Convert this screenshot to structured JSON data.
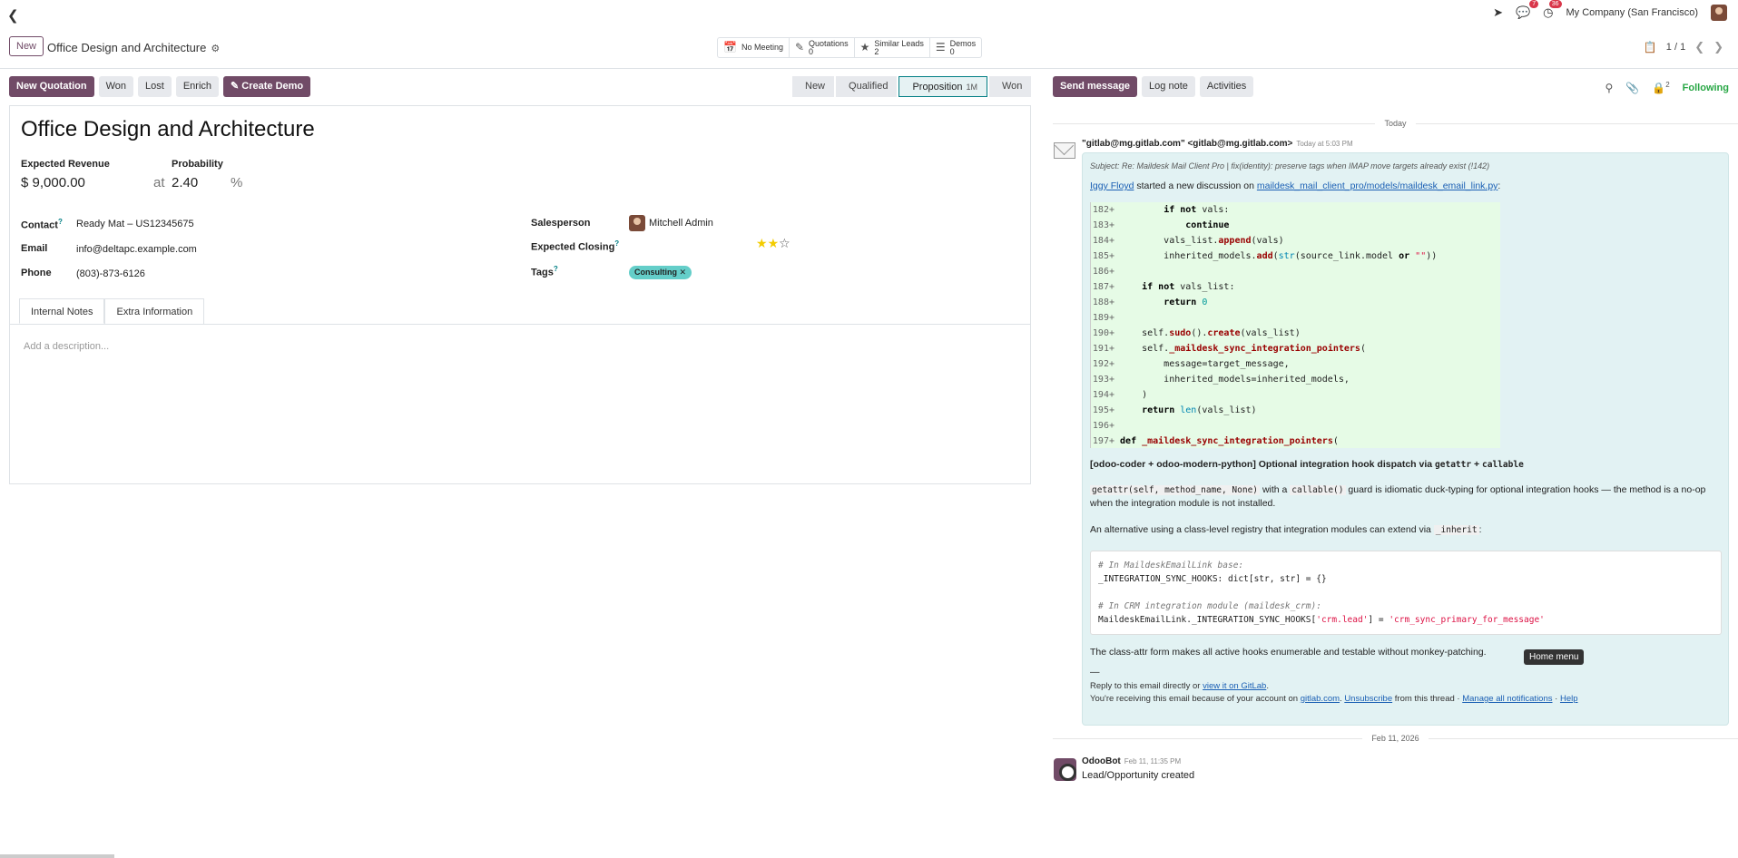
{
  "topbar": {
    "back_icon": "chevron-left-icon",
    "activity_count": "7",
    "messages_count": "36",
    "company": "My Company (San Francisco)"
  },
  "control": {
    "new_label": "New",
    "record_title": "Office Design and Architecture",
    "smart_buttons": [
      {
        "icon": "calendar-icon",
        "label": "No Meeting",
        "count": ""
      },
      {
        "icon": "edit-icon",
        "label": "Quotations",
        "count": "0"
      },
      {
        "icon": "star-icon",
        "label": "Similar Leads",
        "count": "2"
      },
      {
        "icon": "list-icon",
        "label": "Demos",
        "count": "0"
      }
    ],
    "pager": "1 / 1"
  },
  "actions": {
    "new_quotation": "New Quotation",
    "won": "Won",
    "lost": "Lost",
    "enrich": "Enrich",
    "create_demo": "Create Demo"
  },
  "stages": [
    {
      "label": "New",
      "active": false,
      "duration": ""
    },
    {
      "label": "Qualified",
      "active": false,
      "duration": ""
    },
    {
      "label": "Proposition",
      "active": true,
      "duration": "1M"
    },
    {
      "label": "Won",
      "active": false,
      "duration": ""
    }
  ],
  "form": {
    "name": "Office Design and Architecture",
    "expected_revenue_label": "Expected Revenue",
    "expected_revenue": "$ 9,000.00",
    "at_label": "at",
    "probability_label": "Probability",
    "probability": "2.40",
    "percent": "%",
    "contact_label": "Contact",
    "contact": "Ready Mat – US12345675",
    "email_label": "Email",
    "email": "info@deltapc.example.com",
    "phone_label": "Phone",
    "phone": "(803)-873-6126",
    "salesperson_label": "Salesperson",
    "salesperson": "Mitchell Admin",
    "expected_closing_label": "Expected Closing",
    "priority_stars": 2,
    "tags_label": "Tags",
    "tag": "Consulting",
    "tabs": [
      "Internal Notes",
      "Extra Information"
    ],
    "description_placeholder": "Add a description..."
  },
  "chatter": {
    "send_message": "Send message",
    "log_note": "Log note",
    "activities": "Activities",
    "followers_count": "2",
    "following": "Following",
    "date_today": "Today",
    "message": {
      "author": "\"gitlab@mg.gitlab.com\" <gitlab@mg.gitlab.com>",
      "time": "Today at 5:03 PM",
      "subject": "Subject: Re: Maildesk Mail Client Pro | fix(identity): preserve tags when IMAP move targets already exist (!142)",
      "intro_name": "Iggy Floyd",
      "intro_text": " started a new discussion on ",
      "intro_link": "maildesk_mail_client_pro/models/maildesk_email_link.py",
      "intro_end": ":",
      "code_lines": [
        {
          "n": "182+",
          "html": "        <span class='kw'>if not</span> vals:"
        },
        {
          "n": "183+",
          "html": "            <span class='kw'>continue</span>"
        },
        {
          "n": "184+",
          "html": "        vals_list.<span class='fn'>append</span>(vals)"
        },
        {
          "n": "185+",
          "html": "        inherited_models.<span class='fn'>add</span>(<span class='bi'>str</span>(source_link.model <span class='kw'>or</span> <span class='str'>\"\"</span>))"
        },
        {
          "n": "186+",
          "html": ""
        },
        {
          "n": "187+",
          "html": "    <span class='kw'>if not</span> vals_list:"
        },
        {
          "n": "188+",
          "html": "        <span class='kw'>return</span> <span class='num'>0</span>"
        },
        {
          "n": "189+",
          "html": ""
        },
        {
          "n": "190+",
          "html": "    self.<span class='fn'>sudo</span>().<span class='fn'>create</span>(vals_list)"
        },
        {
          "n": "191+",
          "html": "    self.<span class='fn'>_maildesk_sync_integration_pointers</span>("
        },
        {
          "n": "192+",
          "html": "        message=target_message,"
        },
        {
          "n": "193+",
          "html": "        inherited_models=inherited_models,"
        },
        {
          "n": "194+",
          "html": "    )"
        },
        {
          "n": "195+",
          "html": "    <span class='kw'>return</span> <span class='bi'>len</span>(vals_list)"
        },
        {
          "n": "196+",
          "html": ""
        },
        {
          "n": "197+",
          "html": "<span class='kw'>def</span> <span class='fn'>_maildesk_sync_integration_pointers</span>("
        }
      ],
      "heading_prefix": "[odoo-coder + odoo-modern-python] Optional integration hook dispatch via ",
      "heading_code1": "getattr",
      "heading_plus": " + ",
      "heading_code2": "callable",
      "para1_code1": "getattr(self, method_name, None)",
      "para1_mid": " with a ",
      "para1_code2": "callable()",
      "para1_rest": " guard is idiomatic duck-typing for optional integration hooks — the method is a no-op when the integration module is not installed.",
      "para2_text": "An alternative using a class-level registry that integration modules can extend via ",
      "para2_code": "_inherit",
      "para2_end": ":",
      "box_line1": "# In MaildeskEmailLink base:",
      "box_line2": "_INTEGRATION_SYNC_HOOKS: dict[str, str] = {}",
      "box_line3": "# In CRM integration module (maildesk_crm):",
      "box_line4_a": "MaildeskEmailLink._INTEGRATION_SYNC_HOOKS[",
      "box_line4_b": "'crm.lead'",
      "box_line4_c": "] = ",
      "box_line4_d": "'crm_sync_primary_for_message'",
      "para3": "The class-attr form makes all active hooks enumerable and testable without monkey-patching.",
      "dash": "—",
      "reply_text": "Reply to this email directly or ",
      "reply_link": "view it on GitLab",
      "reply_end": ".",
      "receive_text": "You're receiving this email because of your account on ",
      "receive_link1": "gitlab.com",
      "receive_dot": ". ",
      "receive_link2": "Unsubscribe",
      "receive_mid": " from this thread · ",
      "receive_link3": "Manage all notifications",
      "receive_sep": " · ",
      "receive_link4": "Help"
    },
    "tooltip": "Home menu",
    "date2": "Feb 11, 2026",
    "bot_name": "OdooBot",
    "bot_time": "Feb 11, 11:35 PM",
    "bot_text": "Lead/Opportunity created"
  }
}
